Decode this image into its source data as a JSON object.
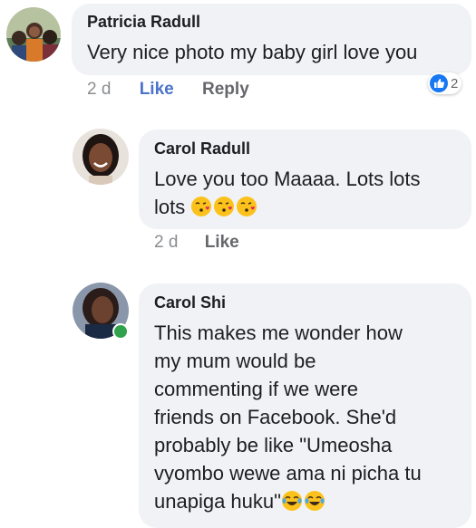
{
  "comments": [
    {
      "author": "Patricia Radull",
      "text": "Very nice photo my baby girl love you",
      "time": "2 d",
      "like_label": "Like",
      "reply_label": "Reply",
      "reaction_icon": "like-icon",
      "reaction_count": "2"
    },
    {
      "author": "Carol Radull",
      "text_line1": "Love you too Maaaa. Lots lots",
      "text_line2": "lots",
      "emojis": [
        "kissing-heart-emoji",
        "kissing-heart-emoji",
        "kissing-heart-emoji"
      ],
      "time": "2 d",
      "like_label": "Like"
    },
    {
      "author": "Carol Shi",
      "online": true,
      "lines": [
        "This makes me wonder how",
        "my mum would be",
        "commenting if we were",
        "friends on Facebook. She'd",
        "probably be like \"Umeosha",
        "vyombo wewe ama ni picha tu"
      ],
      "last_line": "unapiga huku\"",
      "emojis": [
        "tears-of-joy-emoji",
        "tears-of-joy-emoji"
      ]
    }
  ],
  "colors": {
    "bubble": "#f0f2f5",
    "like_blue": "#4a73c9",
    "online_green": "#31a24c"
  }
}
